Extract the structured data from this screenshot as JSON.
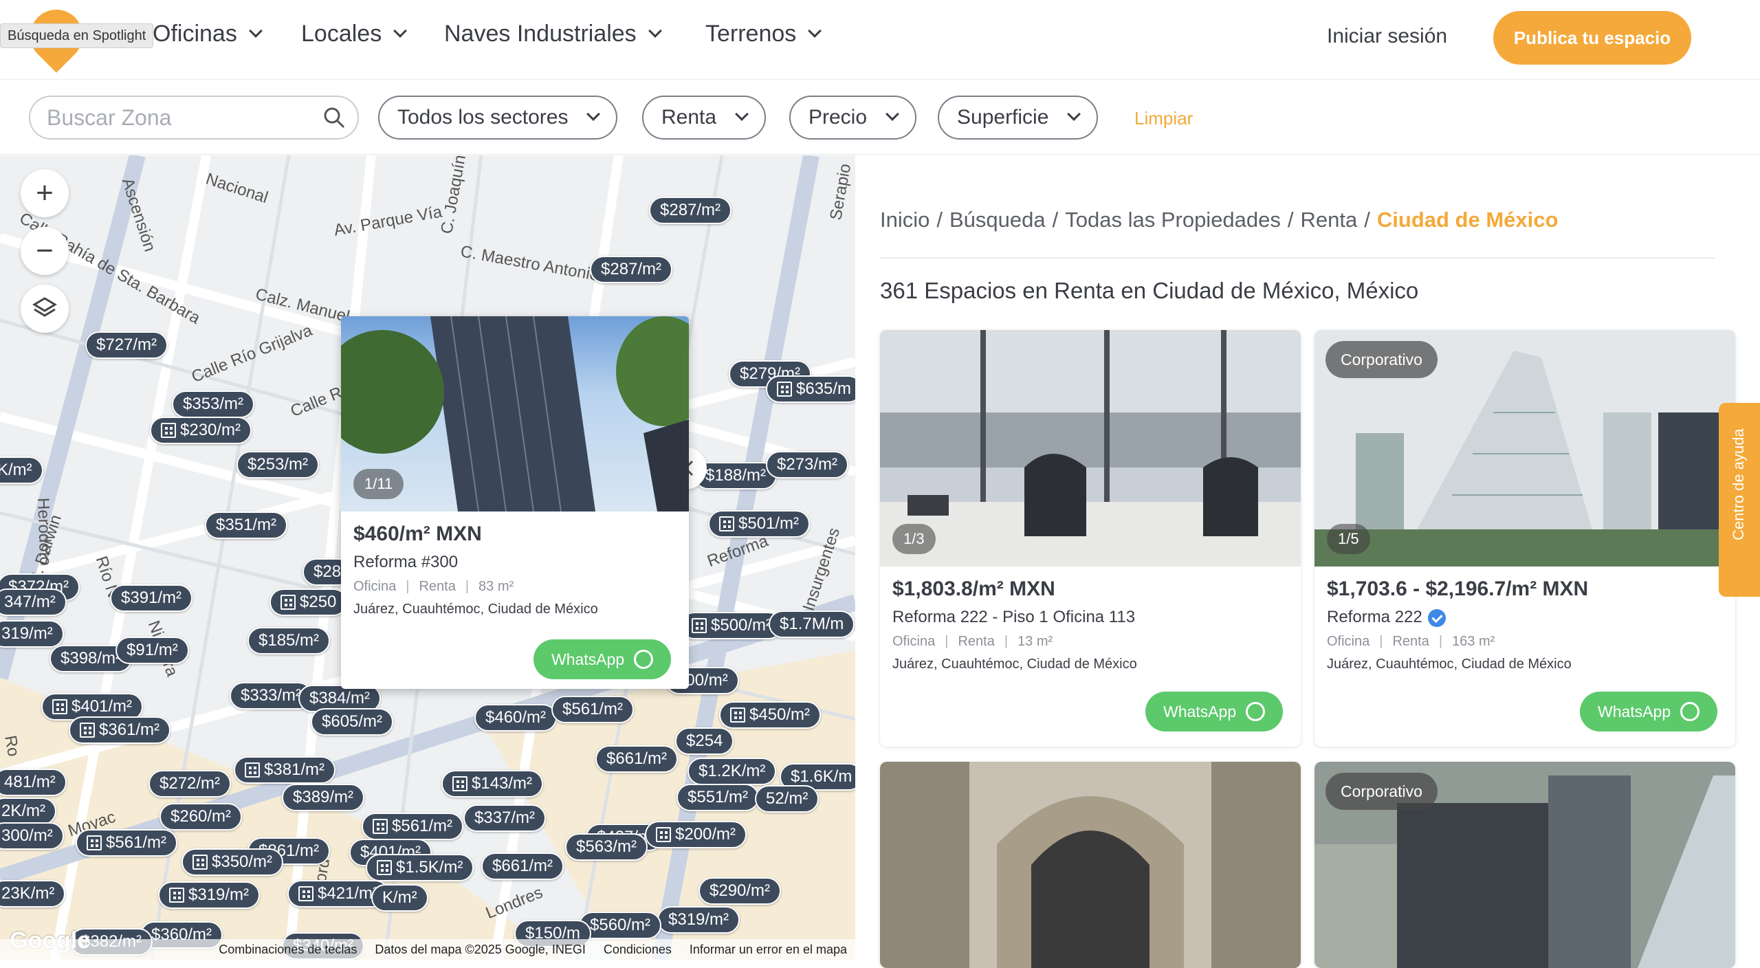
{
  "header": {
    "spotlight_tooltip": "Búsqueda en Spotlight",
    "nav": [
      {
        "label": "Oficinas"
      },
      {
        "label": "Locales"
      },
      {
        "label": "Naves Industriales"
      },
      {
        "label": "Terrenos"
      }
    ],
    "login_label": "Iniciar sesión",
    "publish_label": "Publica tu espacio"
  },
  "filters": {
    "search_placeholder": "Buscar Zona",
    "sector": "Todos los sectores",
    "operation": "Renta",
    "price": "Precio",
    "surface": "Superficie",
    "clear_label": "Limpiar"
  },
  "map": {
    "streets": [
      "Nacional",
      "Av. Parque Vía",
      "C. Maestro Antonio",
      "C. Joaquín",
      "Serapio",
      "Calz. Manuel",
      "Calle Bahía de Sta. Barbara",
      "Ascensión",
      "Calle Río Grijalva",
      "Calle Río",
      "Herodoto",
      "C. Darwin",
      "Río N",
      "Niagara",
      "Reforma",
      "Insurgentes",
      "Londres",
      "Oxford",
      "Moyac",
      "Ro"
    ],
    "price_pins": [
      {
        "label": "$287/m²"
      },
      {
        "label": "$287/m²"
      },
      {
        "label": "$727/m²"
      },
      {
        "label": "$279/m²"
      },
      {
        "label": "$635/m"
      },
      {
        "label": "$353/m²"
      },
      {
        "label": "$230/m²"
      },
      {
        "label": "$253/m²"
      },
      {
        "label": "K/m²"
      },
      {
        "label": "$188/m²"
      },
      {
        "label": "$273/m²"
      },
      {
        "label": "$351/m²"
      },
      {
        "label": "$501/m²"
      },
      {
        "label": "$372/m²"
      },
      {
        "label": "347/m²"
      },
      {
        "label": "$391/m²"
      },
      {
        "label": "$250"
      },
      {
        "label": "$28"
      },
      {
        "label": "319/m²"
      },
      {
        "label": "$398/m²"
      },
      {
        "label": "$91/m²"
      },
      {
        "label": "$185/m²"
      },
      {
        "label": "$500/m²"
      },
      {
        "label": "$1.7M/m"
      },
      {
        "label": "600/m²"
      },
      {
        "label": "$401/m²"
      },
      {
        "label": "$333/m²"
      },
      {
        "label": "$384/m²"
      },
      {
        "label": "$605/m²"
      },
      {
        "label": "$361/m²"
      },
      {
        "label": "$460/m²"
      },
      {
        "label": "$561/m²"
      },
      {
        "label": "$450/m²"
      },
      {
        "label": "$254"
      },
      {
        "label": "$661/m²"
      },
      {
        "label": "481/m²"
      },
      {
        "label": "$272/m²"
      },
      {
        "label": "$381/m²"
      },
      {
        "label": "$1.2K/m²"
      },
      {
        "label": "$143/m²"
      },
      {
        "label": "$1.6K/m"
      },
      {
        "label": "2K/m²"
      },
      {
        "label": "$389/m²"
      },
      {
        "label": "$551/m²"
      },
      {
        "label": "52/m²"
      },
      {
        "label": "300/m²"
      },
      {
        "label": "$260/m²"
      },
      {
        "label": "$561/m²"
      },
      {
        "label": "$337/m²"
      },
      {
        "label": "$427/m"
      },
      {
        "label": "$200/m²"
      },
      {
        "label": "$861/m²"
      },
      {
        "label": "$401/m²"
      },
      {
        "label": "$561/m²"
      },
      {
        "label": "$563/m²"
      },
      {
        "label": "$350/m²"
      },
      {
        "label": "$1.5K/m²"
      },
      {
        "label": "$661/m²"
      },
      {
        "label": "23K/m²"
      },
      {
        "label": "$319/m²"
      },
      {
        "label": "$421/m²"
      },
      {
        "label": "K/m²"
      },
      {
        "label": "$290/m²"
      },
      {
        "label": "$319/m²"
      },
      {
        "label": "$360/m²"
      },
      {
        "label": "$560/m²"
      },
      {
        "label": "$150/m"
      },
      {
        "label": "$382/m²"
      },
      {
        "label": "$340/m²"
      }
    ],
    "footer": [
      "Combinaciones de teclas",
      "Datos del mapa ©2025 Google, INEGI",
      "Condiciones",
      "Informar un error en el mapa"
    ],
    "google_label": "Google"
  },
  "popup": {
    "counter": "1/11",
    "price": "$460/m² MXN",
    "name": "Reforma #300",
    "type": "Oficina",
    "operation": "Renta",
    "area": "83 m²",
    "address": "Juárez, Cuauhtémoc, Ciudad de México",
    "whatsapp_label": "WhatsApp"
  },
  "results": {
    "breadcrumb": [
      "Inicio",
      "Búsqueda",
      "Todas las Propiedades",
      "Renta"
    ],
    "breadcrumb_current": "Ciudad de México",
    "count_text": "361 Espacios en Renta en Ciudad de México, México",
    "cards": [
      {
        "badge": "",
        "counter": "1/3",
        "price": "$1,803.8/m² MXN",
        "name": "Reforma 222 - Piso 1 Oficina 113",
        "type": "Oficina",
        "operation": "Renta",
        "area": "13 m²",
        "address": "Juárez, Cuauhtémoc, Ciudad de México",
        "whatsapp_label": "WhatsApp"
      },
      {
        "badge": "Corporativo",
        "counter": "1/5",
        "price": "$1,703.6 - $2,196.7/m² MXN",
        "name": "Reforma 222",
        "type": "Oficina",
        "operation": "Renta",
        "area": "163 m²",
        "address": "Juárez, Cuauhtémoc, Ciudad de México",
        "whatsapp_label": "WhatsApp"
      },
      {
        "badge": ""
      },
      {
        "badge": "Corporativo"
      }
    ],
    "help_label": "Centro de ayuda"
  },
  "colors": {
    "accent": "#f4a93a",
    "whatsapp": "#5cc96b",
    "pin": "#3d4a5c",
    "verified": "#3d8ae6"
  }
}
